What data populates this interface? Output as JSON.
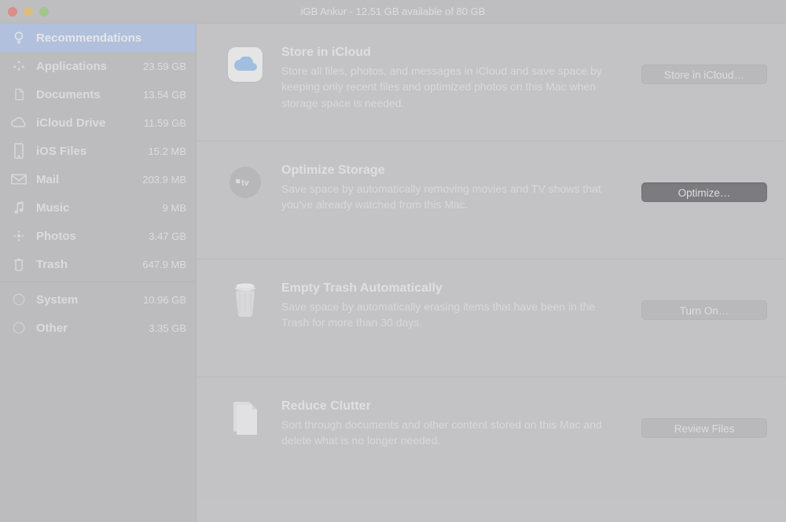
{
  "window": {
    "title": "iGB Ankur - 12.51 GB available of 80 GB"
  },
  "sidebar": {
    "items": [
      {
        "label": "Recommendations",
        "size": "",
        "icon": "bulb",
        "selected": true
      },
      {
        "label": "Applications",
        "size": "23.59 GB",
        "icon": "apps",
        "selected": false
      },
      {
        "label": "Documents",
        "size": "13.54 GB",
        "icon": "doc",
        "selected": false
      },
      {
        "label": "iCloud Drive",
        "size": "11.59 GB",
        "icon": "cloud",
        "selected": false
      },
      {
        "label": "iOS Files",
        "size": "15.2 MB",
        "icon": "phone",
        "selected": false
      },
      {
        "label": "Mail",
        "size": "203.9 MB",
        "icon": "mail",
        "selected": false
      },
      {
        "label": "Music",
        "size": "9 MB",
        "icon": "music",
        "selected": false
      },
      {
        "label": "Photos",
        "size": "3.47 GB",
        "icon": "photos",
        "selected": false
      },
      {
        "label": "Trash",
        "size": "647.9 MB",
        "icon": "trash",
        "selected": false
      }
    ],
    "lower": [
      {
        "label": "System",
        "size": "10.96 GB",
        "icon": "system"
      },
      {
        "label": "Other",
        "size": "3.35 GB",
        "icon": "other"
      }
    ]
  },
  "sections": {
    "icloud": {
      "title": "Store in iCloud",
      "desc": "Store all files, photos, and messages in iCloud and save space by keeping only recent files and optimized photos on this Mac when storage space is needed.",
      "button": "Store in iCloud…"
    },
    "optimize": {
      "title": "Optimize Storage",
      "desc": "Save space by automatically removing movies and TV shows that you've already watched from this Mac.",
      "button": "Optimize…"
    },
    "trash": {
      "title": "Empty Trash Automatically",
      "desc": "Save space by automatically erasing items that have been in the Trash for more than 30 days.",
      "button": "Turn On…"
    },
    "clutter": {
      "title": "Reduce Clutter",
      "desc": "Sort through documents and other content stored on this Mac and delete what is no longer needed.",
      "button": "Review Files"
    }
  }
}
